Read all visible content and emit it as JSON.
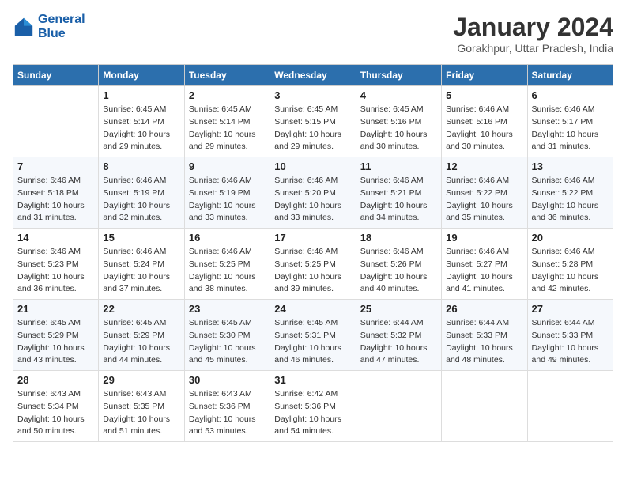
{
  "header": {
    "logo_line1": "General",
    "logo_line2": "Blue",
    "month_title": "January 2024",
    "subtitle": "Gorakhpur, Uttar Pradesh, India"
  },
  "days_of_week": [
    "Sunday",
    "Monday",
    "Tuesday",
    "Wednesday",
    "Thursday",
    "Friday",
    "Saturday"
  ],
  "weeks": [
    [
      {
        "num": "",
        "info": ""
      },
      {
        "num": "1",
        "info": "Sunrise: 6:45 AM\nSunset: 5:14 PM\nDaylight: 10 hours\nand 29 minutes."
      },
      {
        "num": "2",
        "info": "Sunrise: 6:45 AM\nSunset: 5:14 PM\nDaylight: 10 hours\nand 29 minutes."
      },
      {
        "num": "3",
        "info": "Sunrise: 6:45 AM\nSunset: 5:15 PM\nDaylight: 10 hours\nand 29 minutes."
      },
      {
        "num": "4",
        "info": "Sunrise: 6:45 AM\nSunset: 5:16 PM\nDaylight: 10 hours\nand 30 minutes."
      },
      {
        "num": "5",
        "info": "Sunrise: 6:46 AM\nSunset: 5:16 PM\nDaylight: 10 hours\nand 30 minutes."
      },
      {
        "num": "6",
        "info": "Sunrise: 6:46 AM\nSunset: 5:17 PM\nDaylight: 10 hours\nand 31 minutes."
      }
    ],
    [
      {
        "num": "7",
        "info": "Sunrise: 6:46 AM\nSunset: 5:18 PM\nDaylight: 10 hours\nand 31 minutes."
      },
      {
        "num": "8",
        "info": "Sunrise: 6:46 AM\nSunset: 5:19 PM\nDaylight: 10 hours\nand 32 minutes."
      },
      {
        "num": "9",
        "info": "Sunrise: 6:46 AM\nSunset: 5:19 PM\nDaylight: 10 hours\nand 33 minutes."
      },
      {
        "num": "10",
        "info": "Sunrise: 6:46 AM\nSunset: 5:20 PM\nDaylight: 10 hours\nand 33 minutes."
      },
      {
        "num": "11",
        "info": "Sunrise: 6:46 AM\nSunset: 5:21 PM\nDaylight: 10 hours\nand 34 minutes."
      },
      {
        "num": "12",
        "info": "Sunrise: 6:46 AM\nSunset: 5:22 PM\nDaylight: 10 hours\nand 35 minutes."
      },
      {
        "num": "13",
        "info": "Sunrise: 6:46 AM\nSunset: 5:22 PM\nDaylight: 10 hours\nand 36 minutes."
      }
    ],
    [
      {
        "num": "14",
        "info": "Sunrise: 6:46 AM\nSunset: 5:23 PM\nDaylight: 10 hours\nand 36 minutes."
      },
      {
        "num": "15",
        "info": "Sunrise: 6:46 AM\nSunset: 5:24 PM\nDaylight: 10 hours\nand 37 minutes."
      },
      {
        "num": "16",
        "info": "Sunrise: 6:46 AM\nSunset: 5:25 PM\nDaylight: 10 hours\nand 38 minutes."
      },
      {
        "num": "17",
        "info": "Sunrise: 6:46 AM\nSunset: 5:25 PM\nDaylight: 10 hours\nand 39 minutes."
      },
      {
        "num": "18",
        "info": "Sunrise: 6:46 AM\nSunset: 5:26 PM\nDaylight: 10 hours\nand 40 minutes."
      },
      {
        "num": "19",
        "info": "Sunrise: 6:46 AM\nSunset: 5:27 PM\nDaylight: 10 hours\nand 41 minutes."
      },
      {
        "num": "20",
        "info": "Sunrise: 6:46 AM\nSunset: 5:28 PM\nDaylight: 10 hours\nand 42 minutes."
      }
    ],
    [
      {
        "num": "21",
        "info": "Sunrise: 6:45 AM\nSunset: 5:29 PM\nDaylight: 10 hours\nand 43 minutes."
      },
      {
        "num": "22",
        "info": "Sunrise: 6:45 AM\nSunset: 5:29 PM\nDaylight: 10 hours\nand 44 minutes."
      },
      {
        "num": "23",
        "info": "Sunrise: 6:45 AM\nSunset: 5:30 PM\nDaylight: 10 hours\nand 45 minutes."
      },
      {
        "num": "24",
        "info": "Sunrise: 6:45 AM\nSunset: 5:31 PM\nDaylight: 10 hours\nand 46 minutes."
      },
      {
        "num": "25",
        "info": "Sunrise: 6:44 AM\nSunset: 5:32 PM\nDaylight: 10 hours\nand 47 minutes."
      },
      {
        "num": "26",
        "info": "Sunrise: 6:44 AM\nSunset: 5:33 PM\nDaylight: 10 hours\nand 48 minutes."
      },
      {
        "num": "27",
        "info": "Sunrise: 6:44 AM\nSunset: 5:33 PM\nDaylight: 10 hours\nand 49 minutes."
      }
    ],
    [
      {
        "num": "28",
        "info": "Sunrise: 6:43 AM\nSunset: 5:34 PM\nDaylight: 10 hours\nand 50 minutes."
      },
      {
        "num": "29",
        "info": "Sunrise: 6:43 AM\nSunset: 5:35 PM\nDaylight: 10 hours\nand 51 minutes."
      },
      {
        "num": "30",
        "info": "Sunrise: 6:43 AM\nSunset: 5:36 PM\nDaylight: 10 hours\nand 53 minutes."
      },
      {
        "num": "31",
        "info": "Sunrise: 6:42 AM\nSunset: 5:36 PM\nDaylight: 10 hours\nand 54 minutes."
      },
      {
        "num": "",
        "info": ""
      },
      {
        "num": "",
        "info": ""
      },
      {
        "num": "",
        "info": ""
      }
    ]
  ]
}
